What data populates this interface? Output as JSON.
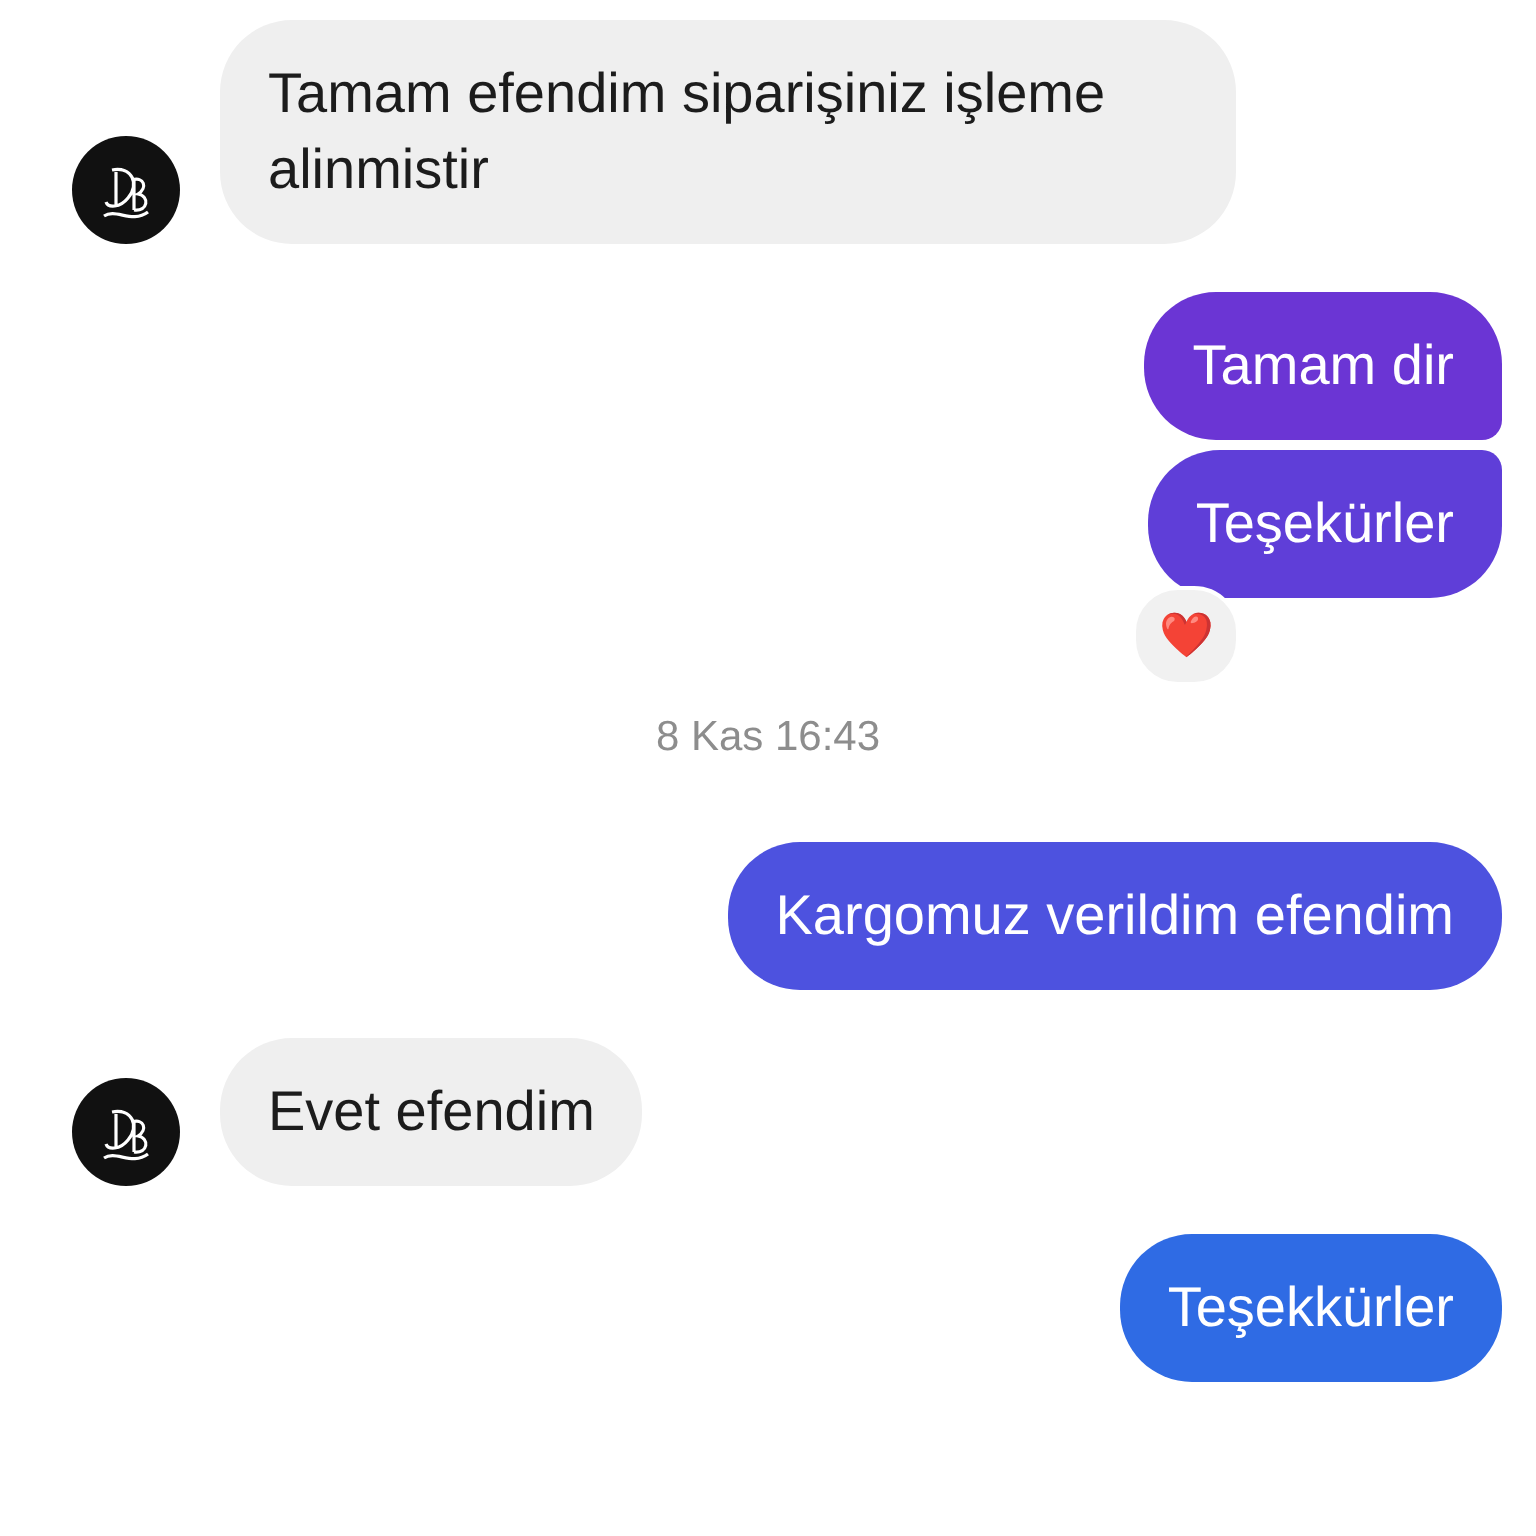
{
  "messages": [
    {
      "kind": "incoming",
      "text": "Tamam efendim siparişiniz işleme alinmistir"
    },
    {
      "kind": "outgoing",
      "text": "Tamam dir",
      "color": "#6b35d4"
    },
    {
      "kind": "outgoing",
      "text": "Teşekürler",
      "color": "#5f3ed8",
      "reaction": "❤️"
    },
    {
      "kind": "timestamp",
      "text": "8 Kas 16:43"
    },
    {
      "kind": "outgoing",
      "text": "Kargomuz verildim efendim",
      "color": "#4d52df"
    },
    {
      "kind": "incoming",
      "text": "Evet efendim"
    },
    {
      "kind": "outgoing",
      "text": "Teşekkürler",
      "color": "#2f6be4"
    }
  ]
}
